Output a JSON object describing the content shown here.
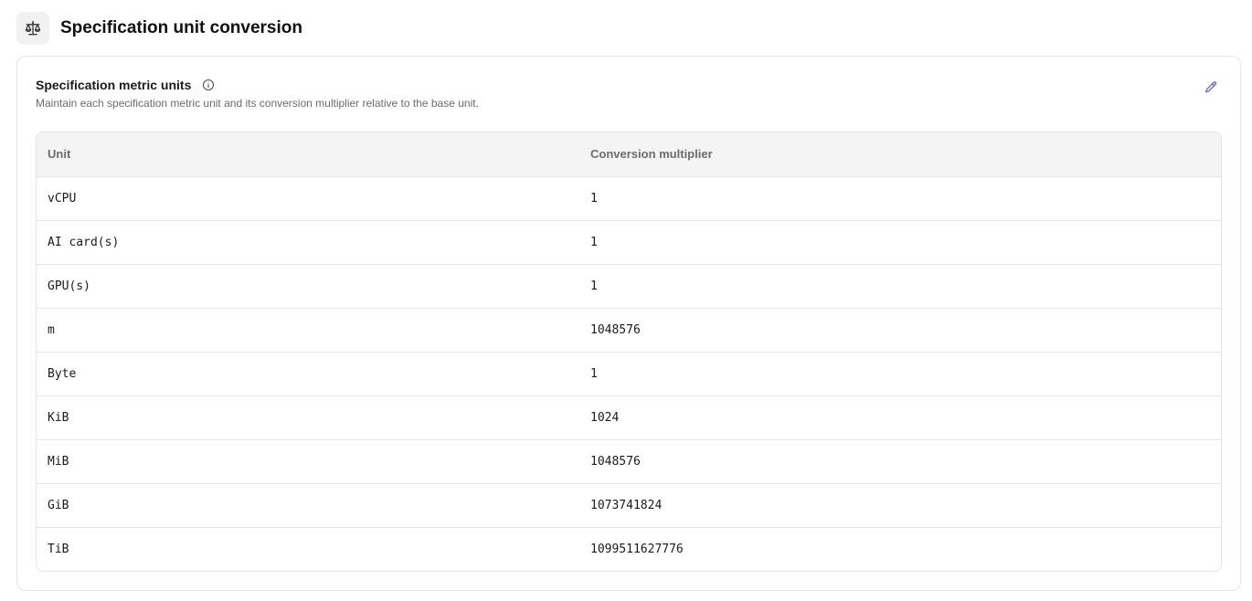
{
  "page": {
    "title": "Specification unit conversion",
    "icon": "scale-icon"
  },
  "card": {
    "title": "Specification metric units",
    "info_icon": "info-icon",
    "description": "Maintain each specification metric unit and its conversion multiplier relative to the base unit.",
    "edit_icon": "pencil-icon",
    "accent_color": "#6d4fd8"
  },
  "table": {
    "headers": [
      "Unit",
      "Conversion multiplier"
    ],
    "rows": [
      {
        "unit": "vCPU",
        "multiplier": "1"
      },
      {
        "unit": "AI card(s)",
        "multiplier": "1"
      },
      {
        "unit": "GPU(s)",
        "multiplier": "1"
      },
      {
        "unit": "m",
        "multiplier": "1048576"
      },
      {
        "unit": "Byte",
        "multiplier": "1"
      },
      {
        "unit": "KiB",
        "multiplier": "1024"
      },
      {
        "unit": "MiB",
        "multiplier": "1048576"
      },
      {
        "unit": "GiB",
        "multiplier": "1073741824"
      },
      {
        "unit": "TiB",
        "multiplier": "1099511627776"
      }
    ]
  }
}
